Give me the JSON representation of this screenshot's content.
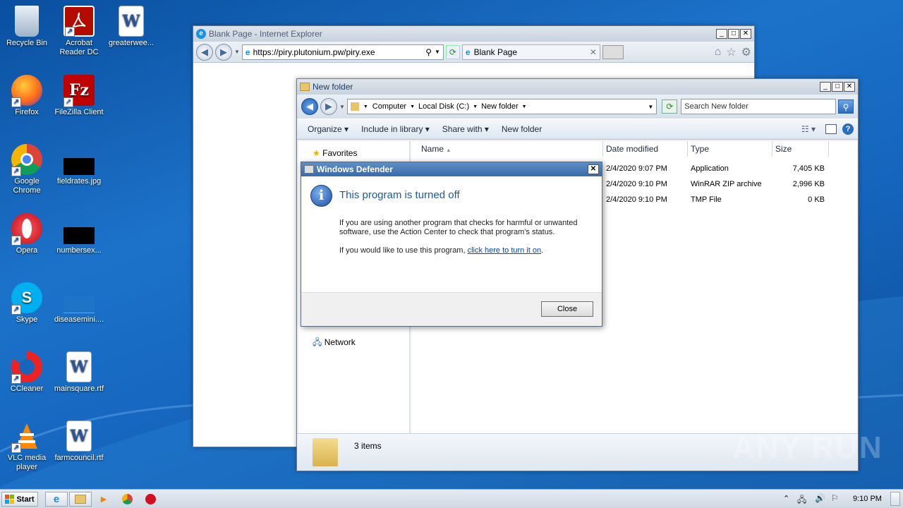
{
  "desktop": {
    "icons": [
      {
        "label": "Recycle Bin",
        "icon": "recycle-bin-icon"
      },
      {
        "label": "Acrobat Reader DC",
        "icon": "acrobat-icon"
      },
      {
        "label": "greaterwee...",
        "icon": "word-doc-icon"
      },
      {
        "label": "Firefox",
        "icon": "firefox-icon"
      },
      {
        "label": "FileZilla Client",
        "icon": "filezilla-icon"
      },
      {
        "label": "Google Chrome",
        "icon": "chrome-icon"
      },
      {
        "label": "fieldrates.jpg",
        "icon": "image-file-icon"
      },
      {
        "label": "Opera",
        "icon": "opera-icon"
      },
      {
        "label": "numbersex...",
        "icon": "image-file-icon"
      },
      {
        "label": "Skype",
        "icon": "skype-icon"
      },
      {
        "label": "diseasemini....",
        "icon": "image-file-icon"
      },
      {
        "label": "CCleaner",
        "icon": "ccleaner-icon"
      },
      {
        "label": "mainsquare.rtf",
        "icon": "word-doc-icon"
      },
      {
        "label": "VLC media player",
        "icon": "vlc-icon"
      },
      {
        "label": "farmcouncil.rtf",
        "icon": "word-doc-icon"
      }
    ]
  },
  "ie": {
    "title": "Blank Page - Internet Explorer",
    "url": "https://piry.plutonium.pw/piry.exe",
    "tab": "Blank Page"
  },
  "explorer": {
    "title": "New folder",
    "breadcrumb": [
      "Computer",
      "Local Disk (C:)",
      "New folder"
    ],
    "search_placeholder": "Search New folder",
    "toolbar": {
      "organize": "Organize",
      "include": "Include in library",
      "share": "Share with",
      "newfolder": "New folder"
    },
    "nav": {
      "favorites": "Favorites",
      "network": "Network"
    },
    "columns": {
      "name": "Name",
      "date": "Date modified",
      "type": "Type",
      "size": "Size"
    },
    "rows": [
      {
        "date": "2/4/2020 9:07 PM",
        "type": "Application",
        "size": "7,405 KB"
      },
      {
        "date": "2/4/2020 9:10 PM",
        "type": "WinRAR ZIP archive",
        "size": "2,996 KB"
      },
      {
        "date": "2/4/2020 9:10 PM",
        "type": "TMP File",
        "size": "0 KB"
      }
    ],
    "status": "3 items"
  },
  "dialog": {
    "title": "Windows Defender",
    "heading": "This program is turned off",
    "body1": "If you are using another program that checks for harmful or unwanted software, use the Action Center to check that program's status.",
    "body2_prefix": "If you would like to use this program, ",
    "body2_link": "click here to turn it on",
    "body2_suffix": ".",
    "close": "Close"
  },
  "taskbar": {
    "start": "Start",
    "clock": "9:10 PM"
  },
  "watermark": "ANY RUN"
}
